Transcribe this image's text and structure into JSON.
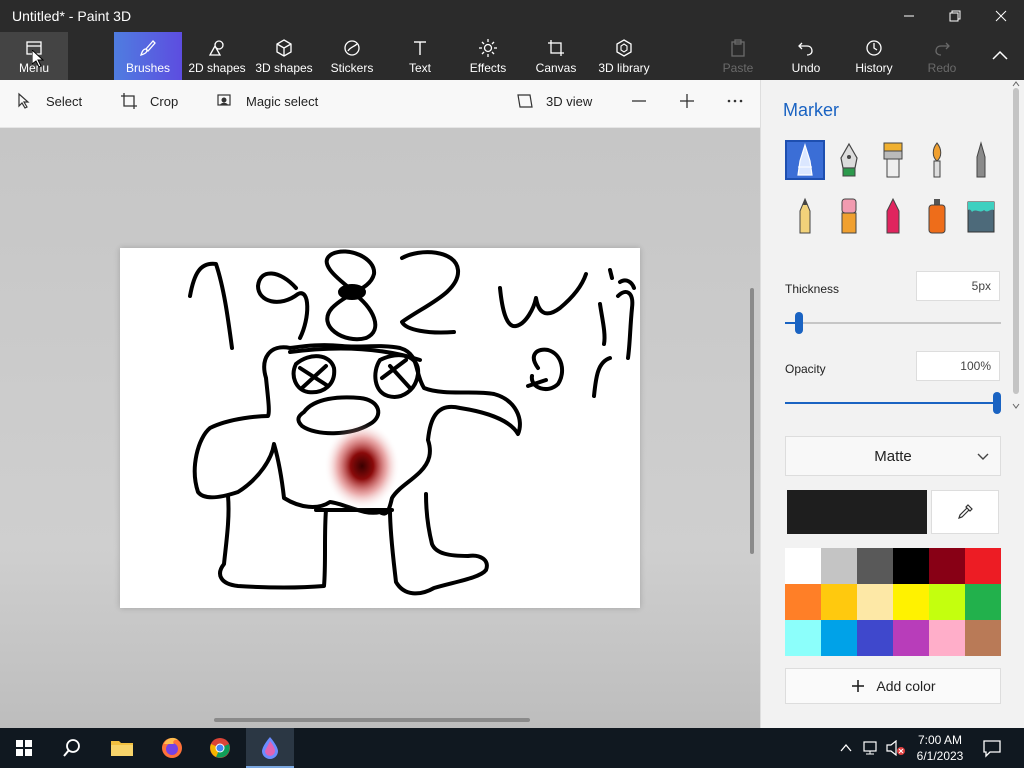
{
  "window": {
    "title": "Untitled* - Paint 3D"
  },
  "ribbon": {
    "menu": "Menu",
    "tabs": [
      "Brushes",
      "2D shapes",
      "3D shapes",
      "Stickers",
      "Text",
      "Effects",
      "Canvas",
      "3D library"
    ],
    "paste": "Paste",
    "undo": "Undo",
    "history": "History",
    "redo": "Redo",
    "active_tab": "Brushes"
  },
  "toolbar": {
    "select": "Select",
    "crop": "Crop",
    "magic_select": "Magic select",
    "view3d": "3D view"
  },
  "panel": {
    "title": "Marker",
    "brushes": [
      "marker-icon",
      "calligraphy-pen-icon",
      "oil-brush-icon",
      "watercolor-icon",
      "pixel-pen-icon",
      "pencil-icon",
      "eraser-icon",
      "crayon-icon",
      "spray-can-icon",
      "fill-icon"
    ],
    "thickness_label": "Thickness",
    "thickness_value": "5px",
    "thickness_level": 0.05,
    "opacity_label": "Opacity",
    "opacity_value": "100%",
    "opacity_level": 1.0,
    "finish": "Matte",
    "current_color": "#1e1e1e",
    "swatches": [
      "#ffffff",
      "#c4c4c4",
      "#595959",
      "#000000",
      "#880015",
      "#ed1c24",
      "#ff7f27",
      "#ffc90e",
      "#fde8a6",
      "#fff200",
      "#c4ff0e",
      "#22b14c",
      "#8cfffb",
      "#00a2e8",
      "#3f48cc",
      "#b83dba",
      "#ffaec9",
      "#b97a57"
    ],
    "add_color": "Add color"
  },
  "canvas_drawing": {
    "text_strokes": [
      "1982",
      "win",
      "or"
    ]
  },
  "taskbar": {
    "time": "7:00 AM",
    "date": "6/1/2023",
    "apps": [
      "start-icon",
      "search-icon",
      "file-explorer-icon",
      "firefox-icon",
      "chrome-icon",
      "paint3d-icon"
    ]
  },
  "colors": {
    "accent": "#1a63c2",
    "ribbon_bg": "#2b2b2b",
    "active_tab": "#5a6de0"
  }
}
